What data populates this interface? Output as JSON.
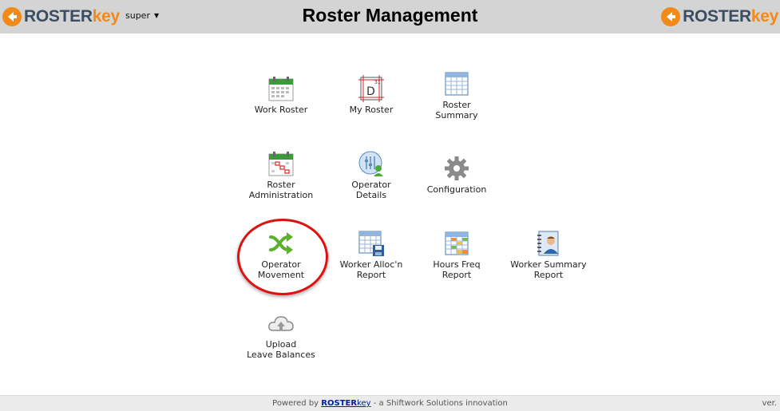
{
  "header": {
    "title": "Roster Management",
    "user": "super",
    "logo_roster": "ROSTER",
    "logo_key": "key"
  },
  "tiles": [
    {
      "label": "Work Roster",
      "icon": "calendar-grid-icon"
    },
    {
      "label": "My Roster",
      "icon": "day-calendar-icon"
    },
    {
      "label": "Roster\nSummary",
      "icon": "table-icon"
    },
    {
      "label": "Roster\nAdministration",
      "icon": "calendar-edit-icon"
    },
    {
      "label": "Operator\nDetails",
      "icon": "operator-details-icon"
    },
    {
      "label": "Configuration",
      "icon": "gear-icon"
    },
    {
      "label": "Operator\nMovement",
      "icon": "shuffle-arrows-icon"
    },
    {
      "label": "Worker Alloc'n\nReport",
      "icon": "table-save-icon"
    },
    {
      "label": "Hours Freq\nReport",
      "icon": "colored-table-icon"
    },
    {
      "label": "Worker Summary\nReport",
      "icon": "notebook-person-icon"
    },
    {
      "label": "Upload\nLeave Balances",
      "icon": "cloud-upload-icon"
    }
  ],
  "footer": {
    "powered_by": "Powered by",
    "brand_roster": "ROSTER",
    "brand_key": "key",
    "tagline": " - a Shiftwork Solutions innovation",
    "version": "ver."
  },
  "colors": {
    "header_bg": "#d4d4d4",
    "logo_blue": "#3a4d63",
    "logo_orange": "#f28a1a",
    "highlight_red": "#e01010"
  }
}
